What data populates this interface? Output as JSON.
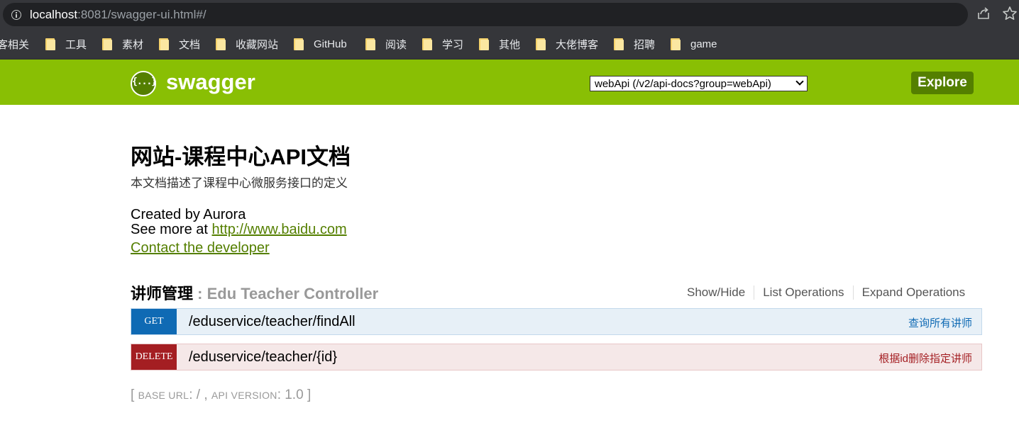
{
  "browser": {
    "url_host": "localhost",
    "url_rest": ":8081/swagger-ui.html#/"
  },
  "bookmarks": [
    {
      "label": "客相关",
      "folder": false
    },
    {
      "label": "工具",
      "folder": true
    },
    {
      "label": "素材",
      "folder": true
    },
    {
      "label": "文档",
      "folder": true
    },
    {
      "label": "收藏网站",
      "folder": true
    },
    {
      "label": "GitHub",
      "folder": true
    },
    {
      "label": "阅读",
      "folder": true
    },
    {
      "label": "学习",
      "folder": true
    },
    {
      "label": "其他",
      "folder": true
    },
    {
      "label": "大佬博客",
      "folder": true
    },
    {
      "label": "招聘",
      "folder": true
    },
    {
      "label": "game",
      "folder": true
    }
  ],
  "header": {
    "logo_glyph": "{...}",
    "logo_text": "swagger",
    "api_selector": "webApi (/v2/api-docs?group=webApi)",
    "explore_label": "Explore",
    "colors": {
      "header_bg": "#89bf04",
      "accent": "#547f00"
    }
  },
  "info": {
    "title": "网站-课程中心API文档",
    "description": "本文档描述了课程中心微服务接口的定义",
    "created_by": "Created by Aurora",
    "see_more_prefix": "See more at ",
    "see_more_link": "http://www.baidu.com",
    "contact_link": "Contact the developer"
  },
  "resource": {
    "name": "讲师管理",
    "separator": " : ",
    "controller": "Edu Teacher Controller",
    "links": [
      "Show/Hide",
      "List Operations",
      "Expand Operations"
    ],
    "operations": [
      {
        "method": "GET",
        "path": "/eduservice/teacher/findAll",
        "summary": "查询所有讲师",
        "color": "#0f6ab4"
      },
      {
        "method": "DELETE",
        "path": "/eduservice/teacher/{id}",
        "summary": "根据id删除指定讲师",
        "color": "#a41e22"
      }
    ]
  },
  "footer": {
    "open": "[ ",
    "base_url_label": "BASE URL",
    "base_url_value": ": / , ",
    "api_version_label": "API VERSION",
    "api_version_value": ": 1.0 ",
    "close": "]"
  }
}
